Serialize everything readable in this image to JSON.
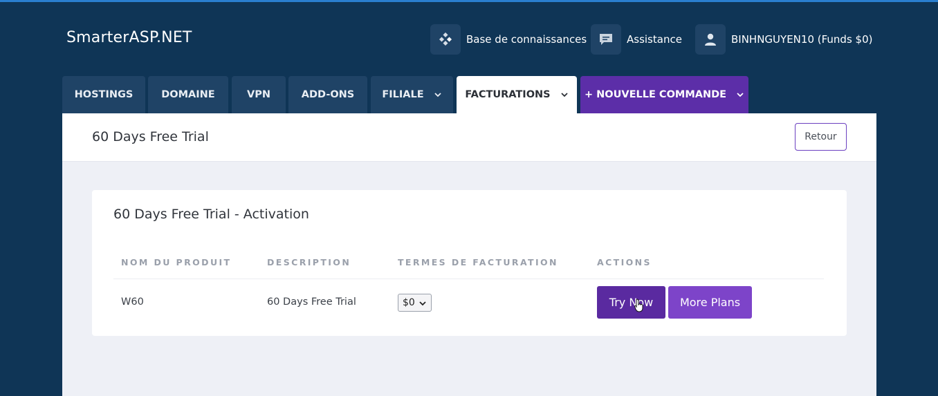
{
  "brand": "SmarterASP.NET",
  "topnav": {
    "knowledge_base": "Base de connaissances",
    "support": "Assistance",
    "account": "BINHNGUYEN10 (Funds $0)"
  },
  "tabs": [
    {
      "label": "HOSTINGS"
    },
    {
      "label": "DOMAINE"
    },
    {
      "label": "VPN"
    },
    {
      "label": "ADD-ONS"
    },
    {
      "label": "FILIALE"
    },
    {
      "label": "FACTURATIONS"
    },
    {
      "label": "+ NOUVELLE COMMANDE"
    }
  ],
  "page": {
    "title": "60 Days Free Trial",
    "back_label": "Retour"
  },
  "card": {
    "title": "60 Days Free Trial - Activation",
    "columns": [
      "NOM DU PRODUIT",
      "DESCRIPTION",
      "TERMES DE FACTURATION",
      "ACTIONS"
    ],
    "row": {
      "product": "W60",
      "description": "60 Days Free Trial",
      "billing_selected": "$0",
      "try_label": "Try Now",
      "more_label": "More Plans"
    }
  },
  "colors": {
    "background": "#0f3556",
    "accent_purple": "#5c2ea8",
    "tab_bg": "#1f4366"
  }
}
